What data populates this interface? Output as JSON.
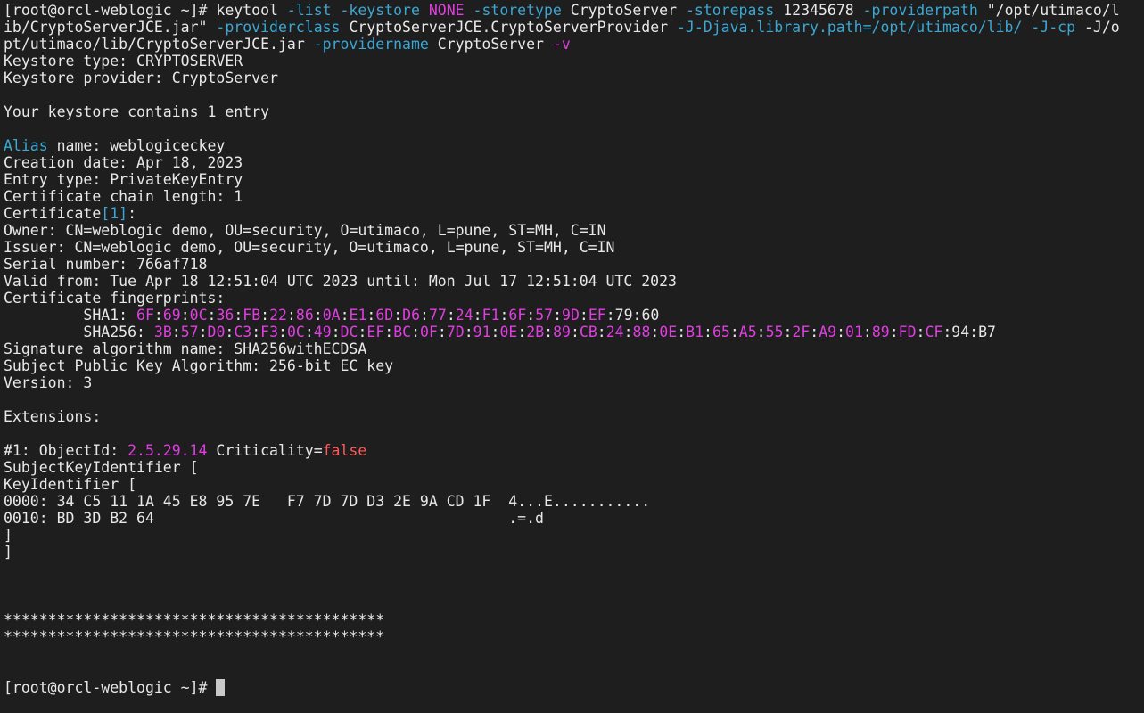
{
  "prompt": "[root@orcl-weblogic ~]#",
  "command": [
    {
      "t": "keytool ",
      "c": ""
    },
    {
      "t": "-list -keystore ",
      "c": "opt"
    },
    {
      "t": "NONE ",
      "c": "mag"
    },
    {
      "t": "-storetype ",
      "c": "opt"
    },
    {
      "t": "CryptoServer ",
      "c": ""
    },
    {
      "t": "-storepass ",
      "c": "opt"
    },
    {
      "t": "12345678 ",
      "c": ""
    },
    {
      "t": "-providerpath ",
      "c": "opt"
    },
    {
      "t": "\"/opt/utimaco/lib/CryptoServerJCE.jar\" ",
      "c": ""
    },
    {
      "t": "-providerclass ",
      "c": "opt"
    },
    {
      "t": "CryptoServerJCE.CryptoServerProvider ",
      "c": ""
    },
    {
      "t": "-J-Djava.library.path=/opt/utimaco/lib/ -J-cp ",
      "c": "opt"
    },
    {
      "t": "-J/opt/utimaco/lib/CryptoServerJCE.jar ",
      "c": ""
    },
    {
      "t": "-providername ",
      "c": "opt"
    },
    {
      "t": "CryptoServer ",
      "c": ""
    },
    {
      "t": "-v",
      "c": "mag"
    }
  ],
  "command_lines": [
    [
      {
        "t": "[root@orcl-weblogic ~]# keytool ",
        "c": ""
      },
      {
        "t": "-list -keystore ",
        "c": "opt"
      },
      {
        "t": "NONE ",
        "c": "mag"
      },
      {
        "t": "-storetype ",
        "c": "opt"
      },
      {
        "t": "CryptoServer ",
        "c": ""
      },
      {
        "t": "-storepass ",
        "c": "opt"
      },
      {
        "t": "12345678 ",
        "c": ""
      },
      {
        "t": "-providerpath ",
        "c": "opt"
      },
      {
        "t": "\"/opt/utimaco/l",
        "c": ""
      }
    ],
    [
      {
        "t": "ib/CryptoServerJCE.jar\" ",
        "c": ""
      },
      {
        "t": "-providerclass ",
        "c": "opt"
      },
      {
        "t": "CryptoServerJCE.CryptoServerProvider ",
        "c": ""
      },
      {
        "t": "-J-Djava.library.path=/opt/utimaco/lib/ -J-cp ",
        "c": "opt"
      },
      {
        "t": "-J/o",
        "c": ""
      }
    ],
    [
      {
        "t": "pt/utimaco/lib/CryptoServerJCE.jar ",
        "c": ""
      },
      {
        "t": "-providername ",
        "c": "opt"
      },
      {
        "t": "CryptoServer ",
        "c": ""
      },
      {
        "t": "-v",
        "c": "mag"
      }
    ]
  ],
  "output_lines": [
    [
      {
        "t": "Keystore type: CRYPTOSERVER",
        "c": ""
      }
    ],
    [
      {
        "t": "Keystore provider: CryptoServer",
        "c": ""
      }
    ],
    [],
    [
      {
        "t": "Your keystore contains 1 entry",
        "c": ""
      }
    ],
    [],
    [
      {
        "t": "Alias",
        "c": "opt"
      },
      {
        "t": " name: weblogiceckey",
        "c": ""
      }
    ],
    [
      {
        "t": "Creation date: Apr 18, 2023",
        "c": ""
      }
    ],
    [
      {
        "t": "Entry type: PrivateKeyEntry",
        "c": ""
      }
    ],
    [
      {
        "t": "Certificate chain length: 1",
        "c": ""
      }
    ],
    [
      {
        "t": "Certificate",
        "c": ""
      },
      {
        "t": "[1]",
        "c": "opt"
      },
      {
        "t": ":",
        "c": ""
      }
    ],
    [
      {
        "t": "Owner: CN=weblogic demo, OU=security, O=utimaco, L=pune, ST=MH, C=IN",
        "c": ""
      }
    ],
    [
      {
        "t": "Issuer: CN=weblogic demo, OU=security, O=utimaco, L=pune, ST=MH, C=IN",
        "c": ""
      }
    ],
    [
      {
        "t": "Serial number: 766af718",
        "c": ""
      }
    ],
    [
      {
        "t": "Valid from: Tue Apr 18 12:51:04 UTC 2023 until: Mon Jul 17 12:51:04 UTC 2023",
        "c": ""
      }
    ],
    [
      {
        "t": "Certificate fingerprints:",
        "c": ""
      }
    ],
    [
      {
        "t": "         SHA1: ",
        "c": ""
      },
      {
        "t": "6F",
        "c": "mag"
      },
      {
        "t": ":",
        "c": ""
      },
      {
        "t": "69",
        "c": "mag"
      },
      {
        "t": ":",
        "c": ""
      },
      {
        "t": "0C",
        "c": "mag"
      },
      {
        "t": ":",
        "c": ""
      },
      {
        "t": "36",
        "c": "mag"
      },
      {
        "t": ":",
        "c": ""
      },
      {
        "t": "FB",
        "c": "mag"
      },
      {
        "t": ":",
        "c": ""
      },
      {
        "t": "22",
        "c": "mag"
      },
      {
        "t": ":",
        "c": ""
      },
      {
        "t": "86",
        "c": "mag"
      },
      {
        "t": ":",
        "c": ""
      },
      {
        "t": "0A",
        "c": "mag"
      },
      {
        "t": ":",
        "c": ""
      },
      {
        "t": "E1",
        "c": "mag"
      },
      {
        "t": ":",
        "c": ""
      },
      {
        "t": "6D",
        "c": "mag"
      },
      {
        "t": ":",
        "c": ""
      },
      {
        "t": "D6",
        "c": "mag"
      },
      {
        "t": ":",
        "c": ""
      },
      {
        "t": "77",
        "c": "mag"
      },
      {
        "t": ":",
        "c": ""
      },
      {
        "t": "24",
        "c": "mag"
      },
      {
        "t": ":",
        "c": ""
      },
      {
        "t": "F1",
        "c": "mag"
      },
      {
        "t": ":",
        "c": ""
      },
      {
        "t": "6F",
        "c": "mag"
      },
      {
        "t": ":",
        "c": ""
      },
      {
        "t": "57",
        "c": "mag"
      },
      {
        "t": ":",
        "c": ""
      },
      {
        "t": "9D",
        "c": "mag"
      },
      {
        "t": ":",
        "c": ""
      },
      {
        "t": "EF",
        "c": "mag"
      },
      {
        "t": ":79:60",
        "c": ""
      }
    ],
    [
      {
        "t": "         SHA256: ",
        "c": ""
      },
      {
        "t": "3B",
        "c": "mag"
      },
      {
        "t": ":",
        "c": ""
      },
      {
        "t": "57",
        "c": "mag"
      },
      {
        "t": ":",
        "c": ""
      },
      {
        "t": "D0",
        "c": "mag"
      },
      {
        "t": ":",
        "c": ""
      },
      {
        "t": "C3",
        "c": "mag"
      },
      {
        "t": ":",
        "c": ""
      },
      {
        "t": "F3",
        "c": "mag"
      },
      {
        "t": ":",
        "c": ""
      },
      {
        "t": "0C",
        "c": "mag"
      },
      {
        "t": ":",
        "c": ""
      },
      {
        "t": "49",
        "c": "mag"
      },
      {
        "t": ":",
        "c": ""
      },
      {
        "t": "DC",
        "c": "mag"
      },
      {
        "t": ":",
        "c": ""
      },
      {
        "t": "EF",
        "c": "mag"
      },
      {
        "t": ":",
        "c": ""
      },
      {
        "t": "BC",
        "c": "mag"
      },
      {
        "t": ":",
        "c": ""
      },
      {
        "t": "0F",
        "c": "mag"
      },
      {
        "t": ":",
        "c": ""
      },
      {
        "t": "7D",
        "c": "mag"
      },
      {
        "t": ":",
        "c": ""
      },
      {
        "t": "91",
        "c": "mag"
      },
      {
        "t": ":",
        "c": ""
      },
      {
        "t": "0E",
        "c": "mag"
      },
      {
        "t": ":",
        "c": ""
      },
      {
        "t": "2B",
        "c": "mag"
      },
      {
        "t": ":",
        "c": ""
      },
      {
        "t": "89",
        "c": "mag"
      },
      {
        "t": ":",
        "c": ""
      },
      {
        "t": "CB",
        "c": "mag"
      },
      {
        "t": ":",
        "c": ""
      },
      {
        "t": "24",
        "c": "mag"
      },
      {
        "t": ":",
        "c": ""
      },
      {
        "t": "88",
        "c": "mag"
      },
      {
        "t": ":",
        "c": ""
      },
      {
        "t": "0E",
        "c": "mag"
      },
      {
        "t": ":",
        "c": ""
      },
      {
        "t": "B1",
        "c": "mag"
      },
      {
        "t": ":",
        "c": ""
      },
      {
        "t": "65",
        "c": "mag"
      },
      {
        "t": ":",
        "c": ""
      },
      {
        "t": "A5",
        "c": "mag"
      },
      {
        "t": ":",
        "c": ""
      },
      {
        "t": "55",
        "c": "mag"
      },
      {
        "t": ":",
        "c": ""
      },
      {
        "t": "2F",
        "c": "mag"
      },
      {
        "t": ":",
        "c": ""
      },
      {
        "t": "A9",
        "c": "mag"
      },
      {
        "t": ":",
        "c": ""
      },
      {
        "t": "01",
        "c": "mag"
      },
      {
        "t": ":",
        "c": ""
      },
      {
        "t": "89",
        "c": "mag"
      },
      {
        "t": ":",
        "c": ""
      },
      {
        "t": "FD",
        "c": "mag"
      },
      {
        "t": ":",
        "c": ""
      },
      {
        "t": "CF",
        "c": "mag"
      },
      {
        "t": ":94:B7",
        "c": ""
      }
    ],
    [
      {
        "t": "Signature algorithm name: SHA256withECDSA",
        "c": ""
      }
    ],
    [
      {
        "t": "Subject Public Key Algorithm: 256-bit EC key",
        "c": ""
      }
    ],
    [
      {
        "t": "Version: 3",
        "c": ""
      }
    ],
    [],
    [
      {
        "t": "Extensions:",
        "c": ""
      }
    ],
    [],
    [
      {
        "t": "#1: ObjectId: ",
        "c": ""
      },
      {
        "t": "2.5.29.14",
        "c": "mag"
      },
      {
        "t": " Criticality=",
        "c": ""
      },
      {
        "t": "false",
        "c": "red"
      }
    ],
    [
      {
        "t": "SubjectKeyIdentifier [",
        "c": ""
      }
    ],
    [
      {
        "t": "KeyIdentifier [",
        "c": ""
      }
    ],
    [
      {
        "t": "0000: 34 C5 11 1A 45 E8 95 7E   F7 7D 7D D3 2E 9A CD 1F  4...E...........",
        "c": ""
      }
    ],
    [
      {
        "t": "0010: BD 3D B2 64                                        .=.d",
        "c": ""
      }
    ],
    [
      {
        "t": "]",
        "c": ""
      }
    ],
    [
      {
        "t": "]",
        "c": ""
      }
    ],
    [],
    [],
    [],
    [
      {
        "t": "*******************************************",
        "c": ""
      }
    ],
    [
      {
        "t": "*******************************************",
        "c": ""
      }
    ],
    [],
    []
  ],
  "final_prompt": "[root@orcl-weblogic ~]# ",
  "colors": {
    "background": "#1e1e1e",
    "text": "#e8e8e8",
    "option": "#3ba7d4",
    "magenta": "#e03ee0",
    "red": "#ff5a5a",
    "cursor": "#c9c9c9"
  }
}
